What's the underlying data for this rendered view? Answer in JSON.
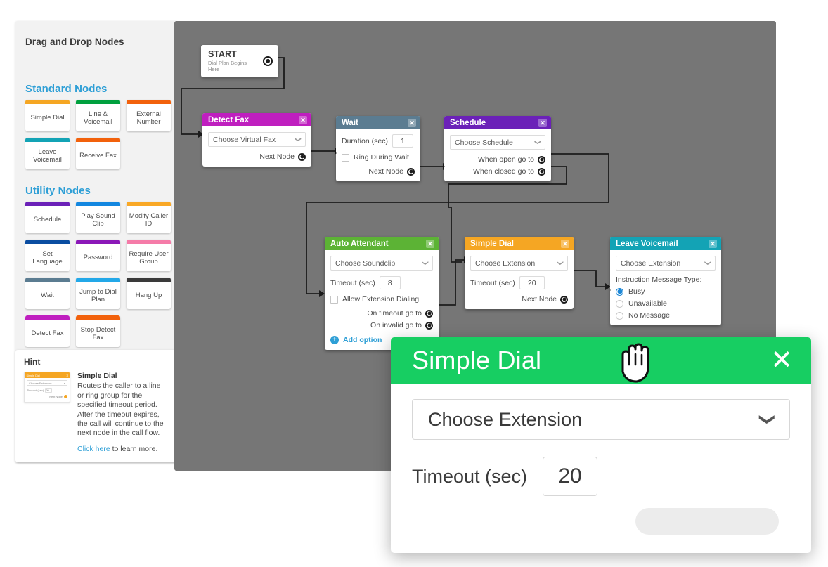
{
  "sidebar": {
    "title": "Drag and Drop Nodes",
    "sections": [
      {
        "heading": "Standard Nodes"
      },
      {
        "heading": "Utility Nodes"
      }
    ],
    "standard_nodes": [
      {
        "label": "Simple Dial",
        "color": "#F5A623"
      },
      {
        "label": "Line & Voicemail",
        "color": "#00A03E"
      },
      {
        "label": "External Number",
        "color": "#F2610C"
      },
      {
        "label": "Leave Voicemail",
        "color": "#13A3B5"
      },
      {
        "label": "Receive Fax",
        "color": "#F2610C"
      }
    ],
    "utility_nodes": [
      {
        "label": "Schedule",
        "color": "#6B21B8"
      },
      {
        "label": "Play Sound Clip",
        "color": "#1387E0"
      },
      {
        "label": "Modify Caller ID",
        "color": "#F9A826"
      },
      {
        "label": "Set Language",
        "color": "#0A4DA1"
      },
      {
        "label": "Password",
        "color": "#8B18B8"
      },
      {
        "label": "Require User Group",
        "color": "#F57BA8"
      },
      {
        "label": "Wait",
        "color": "#5B7C91"
      },
      {
        "label": "Jump to Dial Plan",
        "color": "#23A8E8"
      },
      {
        "label": "Hang Up",
        "color": "#3A3A3A"
      },
      {
        "label": "Detect Fax",
        "color": "#BF1FBF"
      },
      {
        "label": "Stop Detect Fax",
        "color": "#F2610C"
      }
    ]
  },
  "hint": {
    "title": "Hint",
    "node_name": "Simple Dial",
    "description": "Routes the caller to a line or ring group for the specified timeout period. After the timeout expires, the call will continue to the next node in the call flow.",
    "link_text": "Click here",
    "link_suffix": " to learn more.",
    "thumb": {
      "header": "Simple Dial",
      "select": "Choose Extension",
      "timeout_label": "Timeout (sec)",
      "timeout_value": "20",
      "next_label": "Next Node"
    }
  },
  "canvas": {
    "start_node": {
      "title": "START",
      "subtitle": "Dial Plan Begins Here"
    },
    "nodes": [
      {
        "id": "detect-fax",
        "title": "Detect Fax",
        "color": "#BF1FBF",
        "select": "Choose Virtual Fax",
        "next_label": "Next Node"
      },
      {
        "id": "wait",
        "title": "Wait",
        "color": "#5B7C91",
        "duration_label": "Duration (sec)",
        "duration_value": "1",
        "checkbox_label": "Ring During Wait",
        "next_label": "Next Node"
      },
      {
        "id": "schedule",
        "title": "Schedule",
        "color": "#6B21B8",
        "select": "Choose Schedule",
        "open_label": "When open go to",
        "closed_label": "When closed go to"
      },
      {
        "id": "auto-attendant",
        "title": "Auto Attendant",
        "color": "#5CB335",
        "select": "Choose Soundclip",
        "timeout_label": "Timeout (sec)",
        "timeout_value": "8",
        "checkbox_label": "Allow Extension Dialing",
        "timeout_go_label": "On timeout go to",
        "invalid_go_label": "On invalid go to",
        "add_option_label": "Add option"
      },
      {
        "id": "simple-dial",
        "title": "Simple Dial",
        "color": "#F5A623",
        "select": "Choose Extension",
        "timeout_label": "Timeout (sec)",
        "timeout_value": "20",
        "next_label": "Next Node"
      },
      {
        "id": "leave-voicemail",
        "title": "Leave Voicemail",
        "color": "#13A3B5",
        "select": "Choose Extension",
        "message_type_label": "Instruction Message Type:",
        "options": [
          "Busy",
          "Unavailable",
          "No Message"
        ],
        "selected_option": "Busy"
      }
    ]
  },
  "modal": {
    "title": "Simple Dial",
    "close_label": "✕",
    "select_value": "Choose Extension",
    "timeout_label": "Timeout (sec)",
    "timeout_value": "20",
    "accent_color": "#17ce62",
    "cursor": "grab-hand-cursor"
  }
}
